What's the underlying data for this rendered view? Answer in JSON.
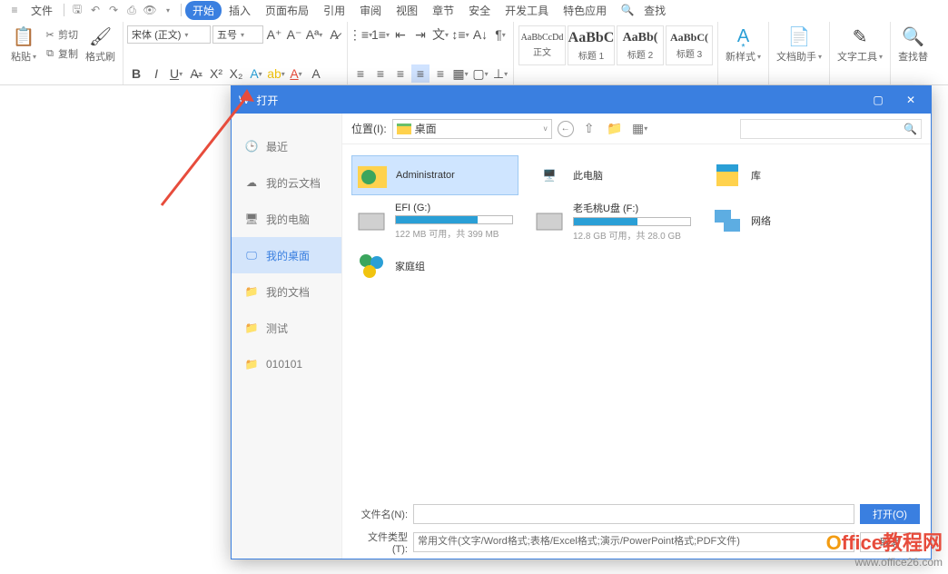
{
  "menu": {
    "file": "文件",
    "start": "开始",
    "insert": "插入",
    "page_layout": "页面布局",
    "refs": "引用",
    "review": "审阅",
    "view": "视图",
    "section": "章节",
    "security": "安全",
    "dev": "开发工具",
    "special": "特色应用",
    "find": "查找"
  },
  "ribbon": {
    "cut": "剪切",
    "copy": "复制",
    "paste": "粘贴",
    "format_painter": "格式刷",
    "font": "宋体 (正文)",
    "font_size": "五号",
    "styles": [
      {
        "preview": "AaBbCcDd",
        "label": "正文"
      },
      {
        "preview": "AaBbC",
        "label": "标题 1"
      },
      {
        "preview": "AaBb(",
        "label": "标题 2"
      },
      {
        "preview": "AaBbC(",
        "label": "标题 3"
      }
    ],
    "new_style": "新样式",
    "doc_helper": "文档助手",
    "text_tools": "文字工具",
    "find_replace": "查找替"
  },
  "dialog": {
    "title": "打开",
    "side": [
      {
        "id": "recent",
        "label": "最近"
      },
      {
        "id": "cloud",
        "label": "我的云文档"
      },
      {
        "id": "pc",
        "label": "我的电脑"
      },
      {
        "id": "desktop",
        "label": "我的桌面"
      },
      {
        "id": "docs",
        "label": "我的文档"
      },
      {
        "id": "test",
        "label": "测试"
      },
      {
        "id": "010101",
        "label": "010101"
      }
    ],
    "location_label": "位置(I):",
    "location_value": "桌面",
    "items": {
      "admin": "Administrator",
      "thispc": "此电脑",
      "lib": "库",
      "efi_name": "EFI (G:)",
      "efi_sub": "122 MB 可用，共 399 MB",
      "usb_name": "老毛桃U盘 (F:)",
      "usb_sub": "12.8 GB 可用，共 28.0 GB",
      "network": "网络",
      "homegroup": "家庭组"
    },
    "efi_fill": 70,
    "usb_fill": 55,
    "filename_label": "文件名(N):",
    "filename_value": "",
    "filetype_label": "文件类型(T):",
    "filetype_value": "常用文件(文字/Word格式;表格/Excel格式;演示/PowerPoint格式;PDF文件)",
    "open_btn": "打开(O)",
    "cancel_btn": "取消"
  },
  "watermark": {
    "brand_prefix": "O",
    "brand_rest": "ffice教程网",
    "url": "www.office26.com"
  }
}
